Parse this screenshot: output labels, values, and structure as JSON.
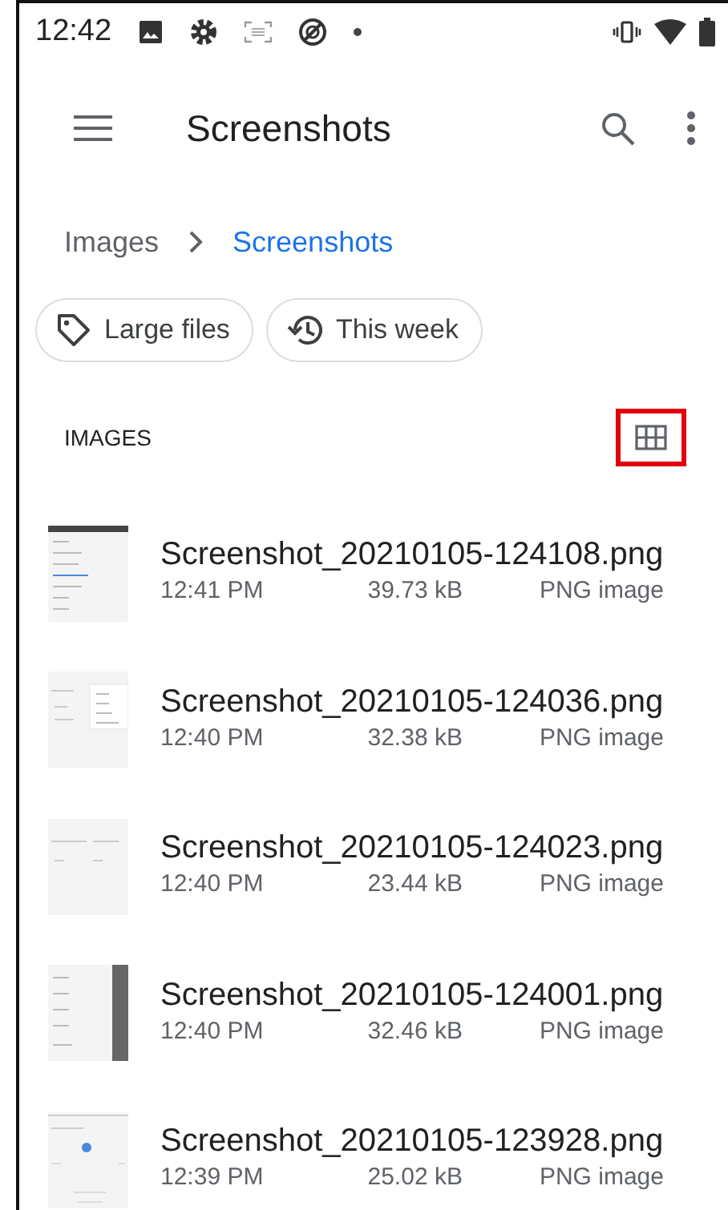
{
  "status_bar": {
    "time": "12:42"
  },
  "app_bar": {
    "title": "Screenshots"
  },
  "breadcrumb": [
    {
      "label": "Images",
      "selected": false
    },
    {
      "label": "Screenshots",
      "selected": true
    }
  ],
  "chips": [
    {
      "kind": "tag",
      "label": "Large files"
    },
    {
      "kind": "history",
      "label": "This week"
    }
  ],
  "section": {
    "title": "IMAGES",
    "view_toggle": {
      "highlighted": true
    }
  },
  "files": [
    {
      "name": "Screenshot_20210105-124108.png",
      "time": "12:41 PM",
      "size": "39.73 kB",
      "type": "PNG image",
      "kind": "menu"
    },
    {
      "name": "Screenshot_20210105-124036.png",
      "time": "12:40 PM",
      "size": "32.38 kB",
      "type": "PNG image",
      "kind": "popup"
    },
    {
      "name": "Screenshot_20210105-124023.png",
      "time": "12:40 PM",
      "size": "23.44 kB",
      "type": "PNG image",
      "kind": "plain"
    },
    {
      "name": "Screenshot_20210105-124001.png",
      "time": "12:40 PM",
      "size": "32.46 kB",
      "type": "PNG image",
      "kind": "drawer"
    },
    {
      "name": "Screenshot_20210105-123928.png",
      "time": "12:39 PM",
      "size": "25.02 kB",
      "type": "PNG image",
      "kind": "chart"
    }
  ]
}
